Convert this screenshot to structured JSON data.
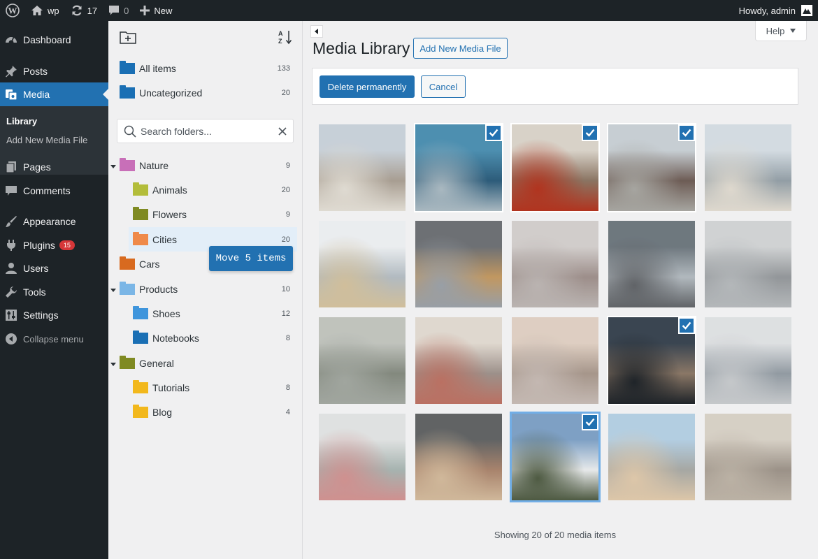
{
  "adminbar": {
    "site_name": "wp",
    "updates": "17",
    "comments": "0",
    "new_label": "New",
    "greeting": "Howdy, admin"
  },
  "menu": {
    "dashboard": "Dashboard",
    "posts": "Posts",
    "media": "Media",
    "library": "Library",
    "add_new_media": "Add New Media File",
    "pages": "Pages",
    "comments": "Comments",
    "appearance": "Appearance",
    "plugins": "Plugins",
    "plugins_badge": "15",
    "users": "Users",
    "tools": "Tools",
    "settings": "Settings",
    "collapse": "Collapse menu"
  },
  "folders": {
    "all_items": {
      "label": "All items",
      "count": "133"
    },
    "uncategorized": {
      "label": "Uncategorized",
      "count": "20"
    },
    "search_placeholder": "Search folders...",
    "tree": [
      {
        "label": "Nature",
        "count": "9",
        "color": "#c86fb8"
      },
      {
        "label": "Animals",
        "count": "20",
        "color": "#b3bd3a"
      },
      {
        "label": "Flowers",
        "count": "9",
        "color": "#7f8a22"
      },
      {
        "label": "Cities",
        "count": "20",
        "color": "#ef8a4a"
      },
      {
        "label": "Cars",
        "count": "",
        "color": "#d86a1f"
      },
      {
        "label": "Products",
        "count": "10",
        "color": "#7bb6e6"
      },
      {
        "label": "Shoes",
        "count": "12",
        "color": "#3f95dc"
      },
      {
        "label": "Notebooks",
        "count": "8",
        "color": "#1a6fb4"
      },
      {
        "label": "General",
        "count": "",
        "color": "#7f8a22"
      },
      {
        "label": "Tutorials",
        "count": "8",
        "color": "#f2b81c"
      },
      {
        "label": "Blog",
        "count": "4",
        "color": "#f2b81c"
      }
    ],
    "move_label": "Move 5 items"
  },
  "main": {
    "title": "Media Library",
    "add_new": "Add New Media File",
    "help": "Help",
    "delete_permanently": "Delete permanently",
    "cancel": "Cancel",
    "showing": "Showing 20 of 20 media items"
  },
  "media_items": [
    {
      "selected": false,
      "colors": [
        "#b8c4cf",
        "#8d7f6e",
        "#d9d3c6"
      ]
    },
    {
      "selected": true,
      "colors": [
        "#4d8fb0",
        "#2d5c7a",
        "#a9b8c0"
      ]
    },
    {
      "selected": true,
      "colors": [
        "#d8d2c8",
        "#8a7462",
        "#b1341f"
      ]
    },
    {
      "selected": true,
      "colors": [
        "#c7ced3",
        "#6d5c55",
        "#a6a5a0"
      ]
    },
    {
      "selected": false,
      "colors": [
        "#c9d4dc",
        "#6f7f89",
        "#d8d0c1"
      ]
    },
    {
      "selected": false,
      "colors": [
        "#e8ecef",
        "#9aa6ae",
        "#c5ac7a"
      ]
    },
    {
      "selected": false,
      "colors": [
        "#3c4045",
        "#b0762a",
        "#77808a"
      ]
    },
    {
      "selected": false,
      "colors": [
        "#c6c0bd",
        "#7d6963",
        "#a69d99"
      ]
    },
    {
      "selected": false,
      "colors": [
        "#3d4a53",
        "#9aa4ab",
        "#2a2e33"
      ]
    },
    {
      "selected": false,
      "colors": [
        "#c4c7c8",
        "#6f7478",
        "#9da2a5"
      ]
    },
    {
      "selected": false,
      "colors": [
        "#aeb2a9",
        "#5a6253",
        "#838a80"
      ]
    },
    {
      "selected": false,
      "colors": [
        "#d9cfc2",
        "#7d6c63",
        "#a6402c"
      ]
    },
    {
      "selected": false,
      "colors": [
        "#d8c2b0",
        "#8a7464",
        "#b3a39a"
      ]
    },
    {
      "selected": true,
      "colors": [
        "#3a4551",
        "#8a7766",
        "#1f2429"
      ]
    },
    {
      "selected": false,
      "colors": [
        "#d7dadc",
        "#6e7a84",
        "#b5b9bc"
      ]
    },
    {
      "selected": false,
      "colors": [
        "#d9dcdb",
        "#8a9c97",
        "#c36c6a"
      ]
    },
    {
      "selected": false,
      "colors": [
        "#2b2e2f",
        "#8d5a3a",
        "#c4a37a"
      ]
    },
    {
      "selected": true,
      "colors": [
        "#7ea0c4",
        "#e7e9ea",
        "#4e5a42"
      ]
    },
    {
      "selected": false,
      "colors": [
        "#9cc1dc",
        "#8a8c86",
        "#d6b78e"
      ]
    },
    {
      "selected": false,
      "colors": [
        "#cdc4b5",
        "#7b6e60",
        "#a79a88"
      ]
    }
  ],
  "colors": {
    "accent": "#2271b1",
    "adminbar": "#1d2327",
    "badge": "#d63638"
  }
}
